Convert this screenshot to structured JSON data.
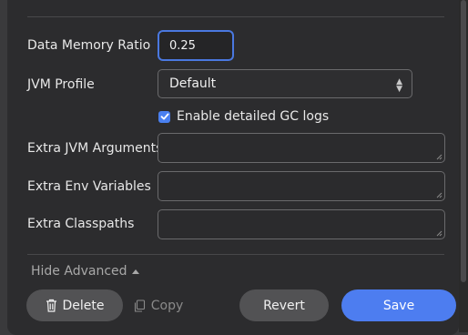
{
  "form": {
    "data_memory_ratio": {
      "label": "Data Memory Ratio",
      "value": "0.25"
    },
    "jvm_profile": {
      "label": "JVM Profile",
      "selected": "Default"
    },
    "gc_logs": {
      "label": "Enable detailed GC logs",
      "checked": true
    },
    "extra_jvm_arguments": {
      "label": "Extra JVM Arguments",
      "value": ""
    },
    "extra_env_variables": {
      "label": "Extra Env Variables",
      "value": ""
    },
    "extra_classpaths": {
      "label": "Extra Classpaths",
      "value": ""
    }
  },
  "advanced_toggle": {
    "label": "Hide Advanced",
    "icon": "caret-up-icon"
  },
  "actions": {
    "delete_label": "Delete",
    "delete_icon": "trash-icon",
    "copy_label": "Copy",
    "copy_icon": "copy-icon",
    "revert_label": "Revert",
    "save_label": "Save"
  },
  "colors": {
    "accent": "#4d7df0",
    "panel_bg": "#2c2c2e",
    "secondary_button": "#525254"
  }
}
